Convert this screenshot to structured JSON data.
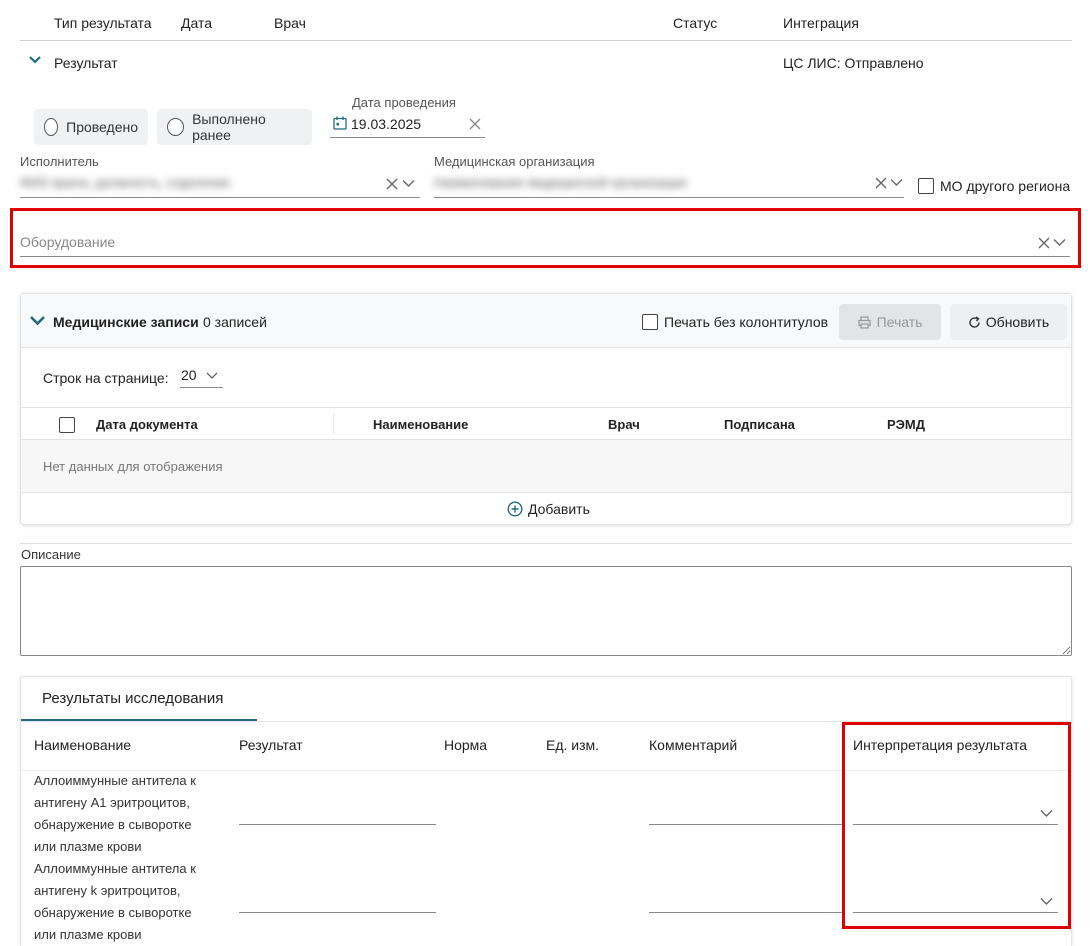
{
  "top_table": {
    "headers": {
      "type": "Тип результата",
      "date": "Дата",
      "doctor": "Врач",
      "status": "Статус",
      "integration": "Интеграция"
    },
    "row": {
      "label": "Результат",
      "integration_value": "ЦС ЛИС: Отправлено"
    }
  },
  "form": {
    "radio_done": "Проведено",
    "radio_earlier": "Выполнено ранее",
    "date_label": "Дата проведения",
    "date_value": "19.03.2025",
    "executor_label": "Исполнитель",
    "executor_value": "ФИО врача, должность, отделение",
    "org_label": "Медицинская организация",
    "org_value": "Наименование медицинской организации",
    "other_region_label": "МО другого региона",
    "equipment_placeholder": "Оборудование"
  },
  "med_records": {
    "title": "Медицинские записи",
    "count": "0 записей",
    "print_no_header": "Печать без колонтитулов",
    "print_button": "Печать",
    "refresh_button": "Обновить",
    "rows_per_page_label": "Строк на странице:",
    "rows_per_page_value": "20",
    "columns": {
      "date": "Дата документа",
      "name": "Наименование",
      "doctor": "Врач",
      "signed": "Подписана",
      "remd": "РЭМД"
    },
    "empty_text": "Нет данных для отображения",
    "add_button": "Добавить"
  },
  "description": {
    "label": "Описание",
    "value": ""
  },
  "results": {
    "tab_label": "Результаты исследования",
    "columns": {
      "name": "Наименование",
      "result": "Результат",
      "norm": "Норма",
      "unit": "Ед. изм.",
      "comment": "Комментарий",
      "interpretation": "Интерпретация результата"
    },
    "rows": [
      {
        "line1": "Аллоиммунные антитела к",
        "line2": "антигену А1 эритроцитов,",
        "line3": "обнаружение в сыворотке",
        "line4": "или плазме крови"
      },
      {
        "line1": "Аллоиммунные антитела к",
        "line2": "антигену k эритроцитов,",
        "line3": "обнаружение в сыворотке",
        "line4": "или плазме крови"
      }
    ]
  },
  "colors": {
    "accent": "#1f6b80",
    "highlight": "#e00000",
    "button_bg": "#f0f1f3"
  }
}
